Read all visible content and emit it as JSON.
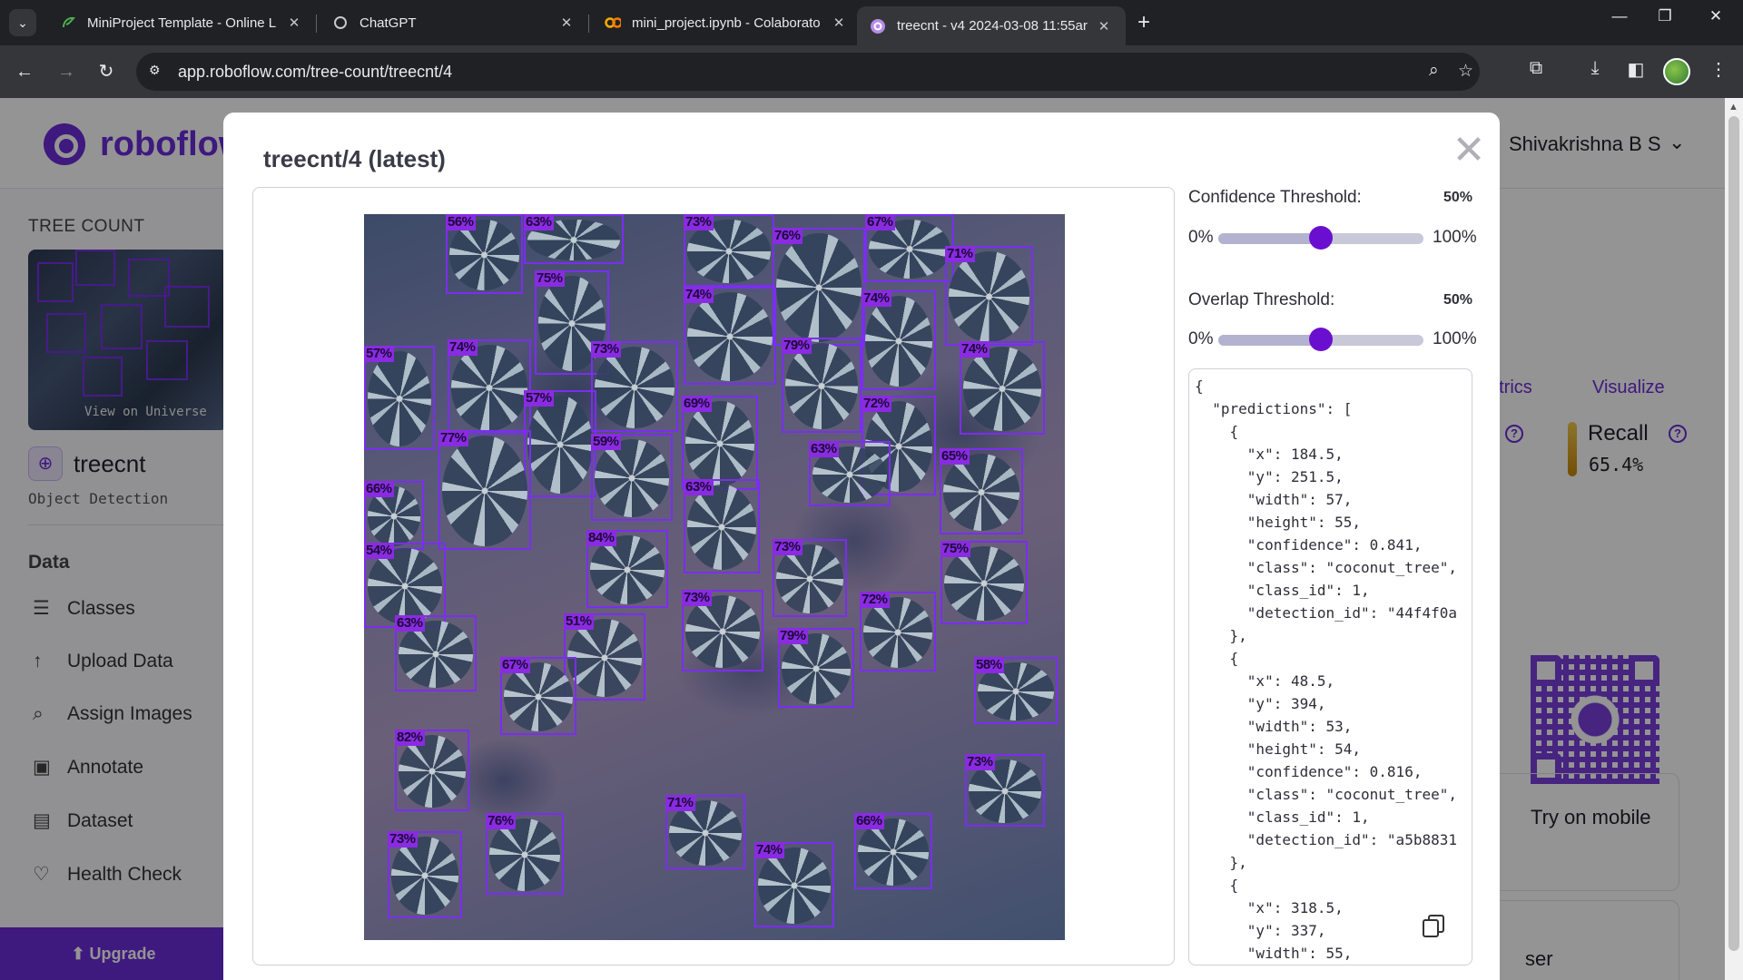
{
  "browser": {
    "tabs": [
      {
        "title": "MiniProject Template - Online L",
        "icon": "overleaf-icon",
        "active": false
      },
      {
        "title": "ChatGPT",
        "icon": "chatgpt-icon",
        "active": false
      },
      {
        "title": "mini_project.ipynb - Colaborato",
        "icon": "colab-icon",
        "active": false
      },
      {
        "title": "treecnt - v4 2024-03-08 11:55ar",
        "icon": "roboflow-icon",
        "active": true
      }
    ],
    "url": "app.roboflow.com/tree-count/treecnt/4"
  },
  "header": {
    "brand": "roboflow",
    "user": "Shivakrishna B S"
  },
  "sidebar": {
    "project_label": "TREE COUNT",
    "thumb_link": "View on Universe",
    "project_name": "treecnt",
    "project_type": "Object Detection",
    "section": "Data",
    "items": [
      {
        "label": "Classes",
        "icon": "list-icon"
      },
      {
        "label": "Upload Data",
        "icon": "upload-icon"
      },
      {
        "label": "Assign Images",
        "icon": "search-icon"
      },
      {
        "label": "Annotate",
        "icon": "annotate-icon"
      },
      {
        "label": "Dataset",
        "icon": "dataset-icon"
      },
      {
        "label": "Health Check",
        "icon": "heart-icon"
      }
    ],
    "upgrade": "Upgrade"
  },
  "background": {
    "tab_metrics": "etrics",
    "tab_visualize": "Visualize",
    "recall_label": "Recall",
    "recall_value": "65.4%",
    "mobile_label": "Try on mobile",
    "partial_text": "ser"
  },
  "modal": {
    "title": "treecnt/4 (latest)",
    "confidence": {
      "label": "Confidence Threshold:",
      "value": "50%",
      "min": "0%",
      "max": "100%",
      "level": 0.5
    },
    "overlap": {
      "label": "Overlap Threshold:",
      "value": "50%",
      "min": "0%",
      "max": "100%",
      "level": 0.5
    },
    "detections": [
      "56%",
      "63%",
      "73%",
      "76%",
      "67%",
      "71%",
      "75%",
      "74%",
      "74%",
      "57%",
      "74%",
      "73%",
      "79%",
      "74%",
      "57%",
      "69%",
      "72%",
      "77%",
      "59%",
      "63%",
      "65%",
      "66%",
      "63%",
      "84%",
      "73%",
      "75%",
      "54%",
      "73%",
      "72%",
      "63%",
      "51%",
      "79%",
      "58%",
      "67%",
      "82%",
      "73%",
      "76%",
      "71%",
      "66%",
      "74%",
      "73%"
    ],
    "json_text": "{\n  \"predictions\": [\n    {\n      \"x\": 184.5,\n      \"y\": 251.5,\n      \"width\": 57,\n      \"height\": 55,\n      \"confidence\": 0.841,\n      \"class\": \"coconut_tree\",\n      \"class_id\": 1,\n      \"detection_id\": \"44f4f0a\n    },\n    {\n      \"x\": 48.5,\n      \"y\": 394,\n      \"width\": 53,\n      \"height\": 54,\n      \"confidence\": 0.816,\n      \"class\": \"coconut_tree\",\n      \"class_id\": 1,\n      \"detection_id\": \"a5b8831\n    },\n    {\n      \"x\": 318.5,\n      \"y\": 337,\n      \"width\": 55,"
  },
  "colors": {
    "accent": "#6c2bd9",
    "box": "#7b2df0",
    "slider_knob": "#6a0fd0"
  }
}
